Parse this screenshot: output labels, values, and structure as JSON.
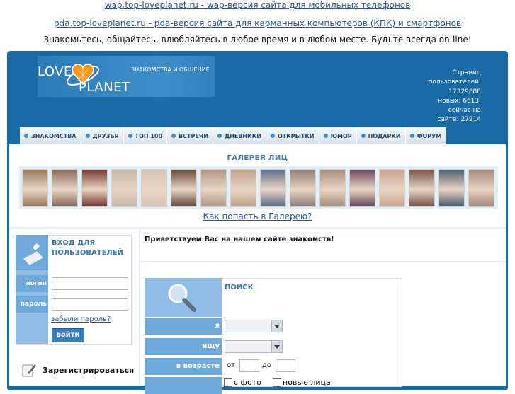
{
  "top_links": {
    "wap": "wap.top-loveplanet.ru - wap-версия сайта для мобильных телефонов",
    "pda": "pda.top-loveplanet.ru - pda-версия сайта для карманных компьютеров (КПК) и смартфонов"
  },
  "tagline": "Знакомьтесь, общайтесь, влюбляйтесь в любое время и в любом месте. Будьте всегда on-line!",
  "logo": {
    "love": "LOVE",
    "planet": "PLANET",
    "subtitle": "ЗНАКОМСТВА И ОБЩЕНИЕ"
  },
  "stats": {
    "line1": "Страниц",
    "line2": "пользователей:",
    "line3": "17329688",
    "line4": "новых: 6613,",
    "line5": "сейчас на",
    "line6": "сайте: 27914"
  },
  "nav": [
    {
      "label": "ЗНАКОМСТВА"
    },
    {
      "label": "ДРУЗЬЯ"
    },
    {
      "label": "ТОП 100"
    },
    {
      "label": "ВСТРЕЧИ"
    },
    {
      "label": "ДНЕВНИКИ"
    },
    {
      "label": "ОТКРЫТКИ"
    },
    {
      "label": "ЮМОР"
    },
    {
      "label": "ПОДАРКИ"
    },
    {
      "label": "ФОРУМ"
    }
  ],
  "gallery": {
    "title": "ГАЛЕРЕЯ ЛИЦ",
    "link": "Как попасть в Галерею?",
    "thumb_colors": [
      "#9a7a5e",
      "#8a6c57",
      "#7a3a30",
      "#c8b8a8",
      "#d7c6b2",
      "#6a4a3a",
      "#b49884",
      "#c2a48a",
      "#5d6f8a",
      "#8e7f76",
      "#a88f7c",
      "#6e4a5e",
      "#c9a58e",
      "#7b5648",
      "#4d5f6f",
      "#a58878"
    ]
  },
  "login": {
    "title_line1": "ВХОД ДЛЯ",
    "title_line2": "ПОЛЬЗОВАТЕЛЕЙ",
    "login_label": "логин",
    "password_label": "пароль",
    "forgot": "забыли пароль?",
    "submit": "войти",
    "register": "Зарегистрироваться"
  },
  "welcome": "Приветствуем Вас на нашем сайте знакомств!",
  "search": {
    "title": "ПОИСК",
    "i_label": "я",
    "seek_label": "ищу",
    "age_label": "в возрасте",
    "from": "от",
    "to": "до",
    "with_photo": "с фото",
    "new_faces": "новые лица"
  },
  "colors": {
    "frame": "#1a6aa6",
    "accent": "#6fa9d9",
    "link": "#2a5599"
  }
}
